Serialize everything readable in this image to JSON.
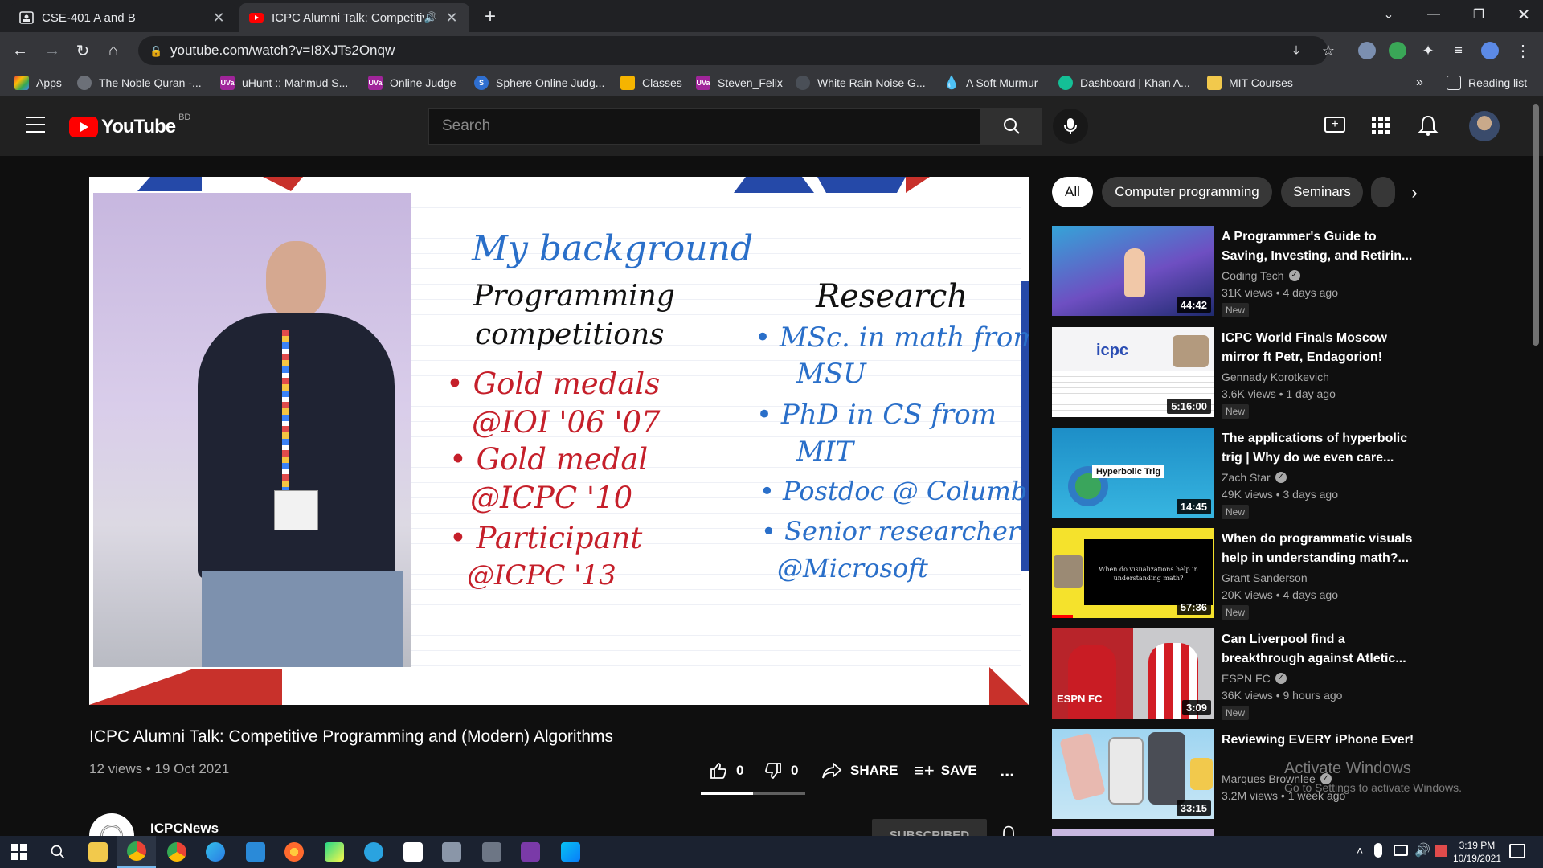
{
  "browser": {
    "tabs": [
      {
        "title": "CSE-401 A and B",
        "active": false
      },
      {
        "title": "ICPC Alumni Talk: Competitiv",
        "active": true
      }
    ],
    "new_tab": "+",
    "url": "youtube.com/watch?v=I8XJTs2Onqw",
    "bookmarks": [
      "Apps",
      "The Noble Quran -...",
      "uHunt :: Mahmud S...",
      "Online Judge",
      "Sphere Online Judg...",
      "Classes",
      "Steven_Felix",
      "White Rain Noise G...",
      "A Soft Murmur",
      "Dashboard | Khan A...",
      "MIT Courses"
    ],
    "bookmarks_more": "»",
    "reading_list": "Reading list"
  },
  "youtube": {
    "logo_text": "YouTube",
    "region": "BD",
    "search_placeholder": "Search"
  },
  "slide": {
    "heading": "My background",
    "left_heading_1": "Programming",
    "left_heading_2": "competitions",
    "left_items": [
      "• Gold medals",
      "@IOI '06 '07",
      "• Gold medal",
      "@ICPC '10",
      "• Participant",
      "@ICPC '13"
    ],
    "right_heading": "Research",
    "right_items": [
      "• MSc. in math from",
      "MSU",
      "• PhD in CS from",
      "MIT",
      "• Postdoc @ Columbia",
      "• Senior researcher",
      "@Microsoft"
    ]
  },
  "video": {
    "title": "ICPC Alumni Talk: Competitive Programming and (Modern) Algorithms",
    "meta": "12 views • 19 Oct 2021",
    "likes": "0",
    "dislikes": "0",
    "share": "SHARE",
    "save": "SAVE",
    "more": "...",
    "channel": "ICPCNews",
    "subscribe": "SUBSCRIBED",
    "like_ratio": 0.5
  },
  "chips": [
    "All",
    "Computer programming",
    "Seminars"
  ],
  "recommendations": [
    {
      "title": "A Programmer's Guide to Saving, Investing, and Retirin...",
      "channel": "Coding Tech",
      "verified": true,
      "stats": "31K views • 4 days ago",
      "badge": "New",
      "duration": "44:42"
    },
    {
      "title": "ICPC World Finals Moscow mirror ft Petr, Endagorion!",
      "channel": "Gennady Korotkevich",
      "verified": false,
      "stats": "3.6K views • 1 day ago",
      "badge": "New",
      "duration": "5:16:00"
    },
    {
      "title": "The applications of hyperbolic trig | Why do we even care...",
      "channel": "Zach Star",
      "verified": true,
      "stats": "49K views • 3 days ago",
      "badge": "New",
      "duration": "14:45",
      "thumb_label": "Hyperbolic Trig"
    },
    {
      "title": "When do programmatic visuals help in understanding math?...",
      "channel": "Grant Sanderson",
      "verified": false,
      "stats": "20K views • 4 days ago",
      "badge": "New",
      "duration": "57:36",
      "thumb_label": "When do visualizations help in understanding math?"
    },
    {
      "title": "Can Liverpool find a breakthrough against Atletic...",
      "channel": "ESPN FC",
      "verified": true,
      "stats": "36K views • 9 hours ago",
      "badge": "New",
      "duration": "3:09"
    },
    {
      "title": "Reviewing EVERY iPhone Ever!",
      "channel": "Marques Brownlee",
      "verified": true,
      "stats": "3.2M views • 1 week ago",
      "badge": "",
      "duration": "33:15"
    }
  ],
  "overlay": {
    "activate_title": "Activate Windows",
    "activate_sub": "Go to Settings to activate Windows."
  },
  "taskbar": {
    "time": "3:19 PM",
    "date": "10/19/2021"
  }
}
